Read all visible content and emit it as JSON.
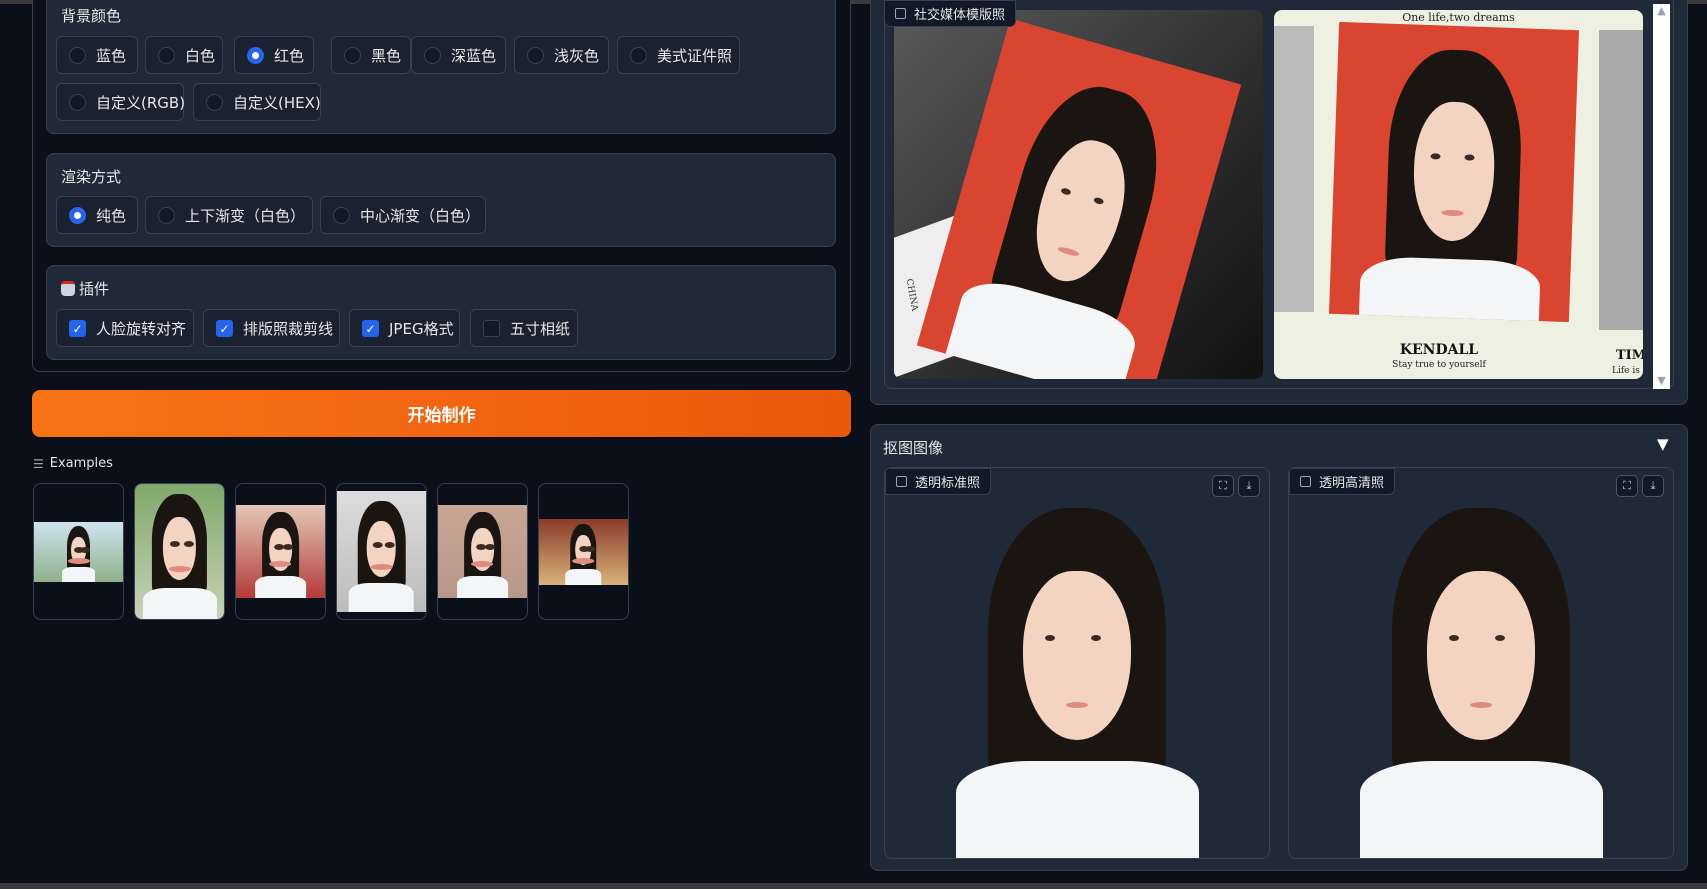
{
  "bg_color": {
    "label": "背景颜色",
    "options": [
      "蓝色",
      "白色",
      "红色",
      "黑色",
      "深蓝色",
      "浅灰色",
      "美式证件照",
      "自定义(RGB)",
      "自定义(HEX)"
    ],
    "selected": "红色"
  },
  "render_mode": {
    "label": "渲染方式",
    "options": [
      "纯色",
      "上下渐变（白色）",
      "中心渐变（白色）"
    ],
    "selected": "纯色"
  },
  "plugins": {
    "label": "插件",
    "icon": "robot-icon",
    "options": [
      {
        "label": "人脸旋转对齐",
        "checked": true
      },
      {
        "label": "排版照裁剪线",
        "checked": true
      },
      {
        "label": "JPEG格式",
        "checked": true
      },
      {
        "label": "五寸相纸",
        "checked": false
      }
    ]
  },
  "start_button": "开始制作",
  "examples": {
    "label": "Examples",
    "count": 6
  },
  "social_template": {
    "label": "社交媒体模版照",
    "card_texts": {
      "top": "One life,two dreams",
      "name": "KENDALL",
      "tagline": "Stay true to yourself",
      "side1": "TIM",
      "side2": "Life is",
      "stamp": "CHINA"
    }
  },
  "matting": {
    "title": "抠图图像",
    "images": [
      {
        "label": "透明标准照"
      },
      {
        "label": "透明高清照"
      }
    ]
  },
  "colors": {
    "accent": "#f97316",
    "checkbox": "#2563eb",
    "photo_bg": "#d94530"
  }
}
